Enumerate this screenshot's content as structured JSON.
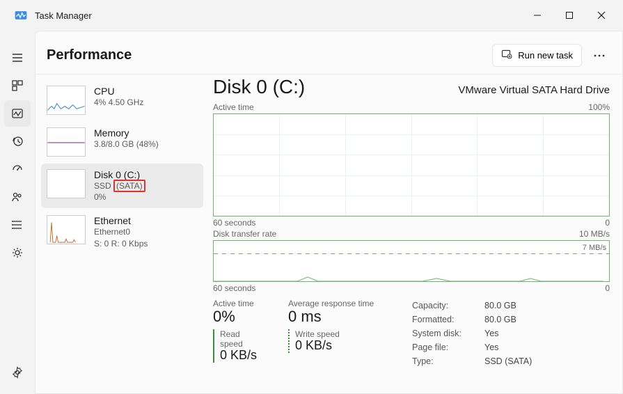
{
  "window": {
    "title": "Task Manager"
  },
  "page": {
    "title": "Performance",
    "run_task_label": "Run new task"
  },
  "sidebar": {
    "items": [
      {
        "title": "CPU",
        "sub": "4%  4.50 GHz"
      },
      {
        "title": "Memory",
        "sub": "3.8/8.0 GB (48%)"
      },
      {
        "title": "Disk 0 (C:)",
        "sub_prefix": "SSD ",
        "sub_highlight": "(SATA)",
        "sub2": "0%"
      },
      {
        "title": "Ethernet",
        "sub": "Ethernet0",
        "sub2": "S: 0 R: 0 Kbps"
      }
    ]
  },
  "detail": {
    "title": "Disk 0 (C:)",
    "device": "VMware Virtual SATA Hard Drive",
    "chart1": {
      "top_left": "Active time",
      "top_right": "100%",
      "foot_left": "60 seconds",
      "foot_right": "0"
    },
    "chart2": {
      "top_left": "Disk transfer rate",
      "top_right": "10 MB/s",
      "inner_right": "7 MB/s",
      "foot_left": "60 seconds",
      "foot_right": "0"
    },
    "stats": {
      "active_time_label": "Active time",
      "active_time": "0%",
      "avg_resp_label": "Average response time",
      "avg_resp": "0 ms",
      "read_label": "Read speed",
      "read": "0 KB/s",
      "write_label": "Write speed",
      "write": "0 KB/s"
    },
    "info": {
      "capacity_k": "Capacity:",
      "capacity_v": "80.0 GB",
      "formatted_k": "Formatted:",
      "formatted_v": "80.0 GB",
      "sysdisk_k": "System disk:",
      "sysdisk_v": "Yes",
      "pagefile_k": "Page file:",
      "pagefile_v": "Yes",
      "type_k": "Type:",
      "type_v": "SSD (SATA)"
    }
  },
  "chart_data": {
    "type": "line",
    "title": "Disk 0 (C:) activity",
    "charts": [
      {
        "name": "Active time",
        "xlabel": "seconds",
        "xrange": [
          60,
          0
        ],
        "ylabel": "%",
        "ylim": [
          0,
          100
        ],
        "values_approx": "flat near 0%"
      },
      {
        "name": "Disk transfer rate",
        "xlabel": "seconds",
        "xrange": [
          60,
          0
        ],
        "ylabel": "MB/s",
        "ylim": [
          0,
          10
        ],
        "reference_line": 7,
        "values_approx": "sporadic small bumps near 0"
      }
    ]
  }
}
